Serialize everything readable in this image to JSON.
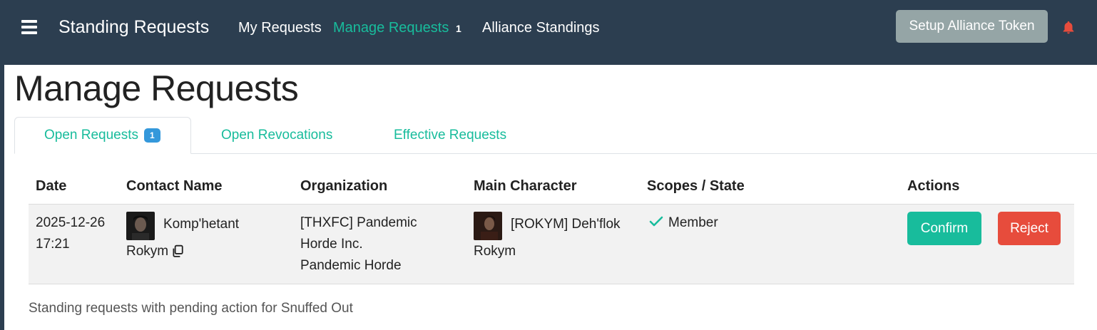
{
  "navbar": {
    "brand": "Standing Requests",
    "links": [
      {
        "label": "My Requests"
      },
      {
        "label": "Manage Requests",
        "active": true,
        "count": "1"
      },
      {
        "label": "Alliance Standings"
      }
    ],
    "token_button": "Setup Alliance Token",
    "bell_color": "#e74c3c"
  },
  "page": {
    "title": "Manage Requests",
    "tabs": [
      {
        "label": "Open Requests",
        "badge": "1",
        "active": true
      },
      {
        "label": "Open Revocations"
      },
      {
        "label": "Effective Requests"
      }
    ]
  },
  "table": {
    "columns": [
      "Date",
      "Contact Name",
      "Organization",
      "Main Character",
      "Scopes / State",
      "Actions"
    ],
    "rows": [
      {
        "date_line1": "2025-12-26",
        "date_line2": "17:21",
        "contact_line1": "Komp'hetant",
        "contact_line2": "Rokym",
        "org_line1": "[THXFC] Pandemic",
        "org_line2": "Horde Inc.",
        "org_line3": "Pandemic Horde",
        "main_line1": "[ROKYM] Deh'flok",
        "main_line2": "Rokym",
        "state": "Member",
        "confirm": "Confirm",
        "reject": "Reject"
      }
    ]
  },
  "caption": "Standing requests with pending action for Snuffed Out",
  "colors": {
    "navbar": "#2c3e50",
    "accent": "#18bc9c",
    "danger": "#e74c3c",
    "badge": "#3498db",
    "secondary": "#95a5a6"
  }
}
